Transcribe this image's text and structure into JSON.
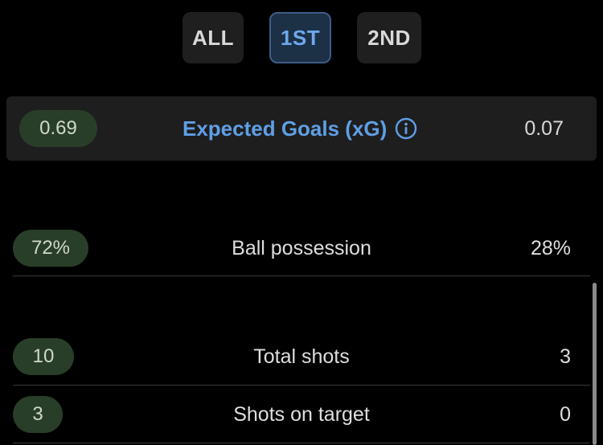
{
  "tabs": [
    {
      "label": "ALL",
      "selected": false
    },
    {
      "label": "1ST",
      "selected": true
    },
    {
      "label": "2ND",
      "selected": false
    }
  ],
  "expected_goals": {
    "title": "Expected Goals (xG)",
    "home": "0.69",
    "away": "0.07",
    "info_icon": "info-circle-icon"
  },
  "stats": [
    {
      "label": "Ball possession",
      "home": "72%",
      "away": "28%"
    },
    {
      "label": "Total shots",
      "home": "10",
      "away": "3"
    },
    {
      "label": "Shots on target",
      "home": "3",
      "away": "0"
    }
  ],
  "colors": {
    "background": "#000000",
    "card": "#1e1e1e",
    "home_pill": "#293e28",
    "accent_blue": "#5f9fe6",
    "selected_tab_bg": "#1c3046"
  }
}
